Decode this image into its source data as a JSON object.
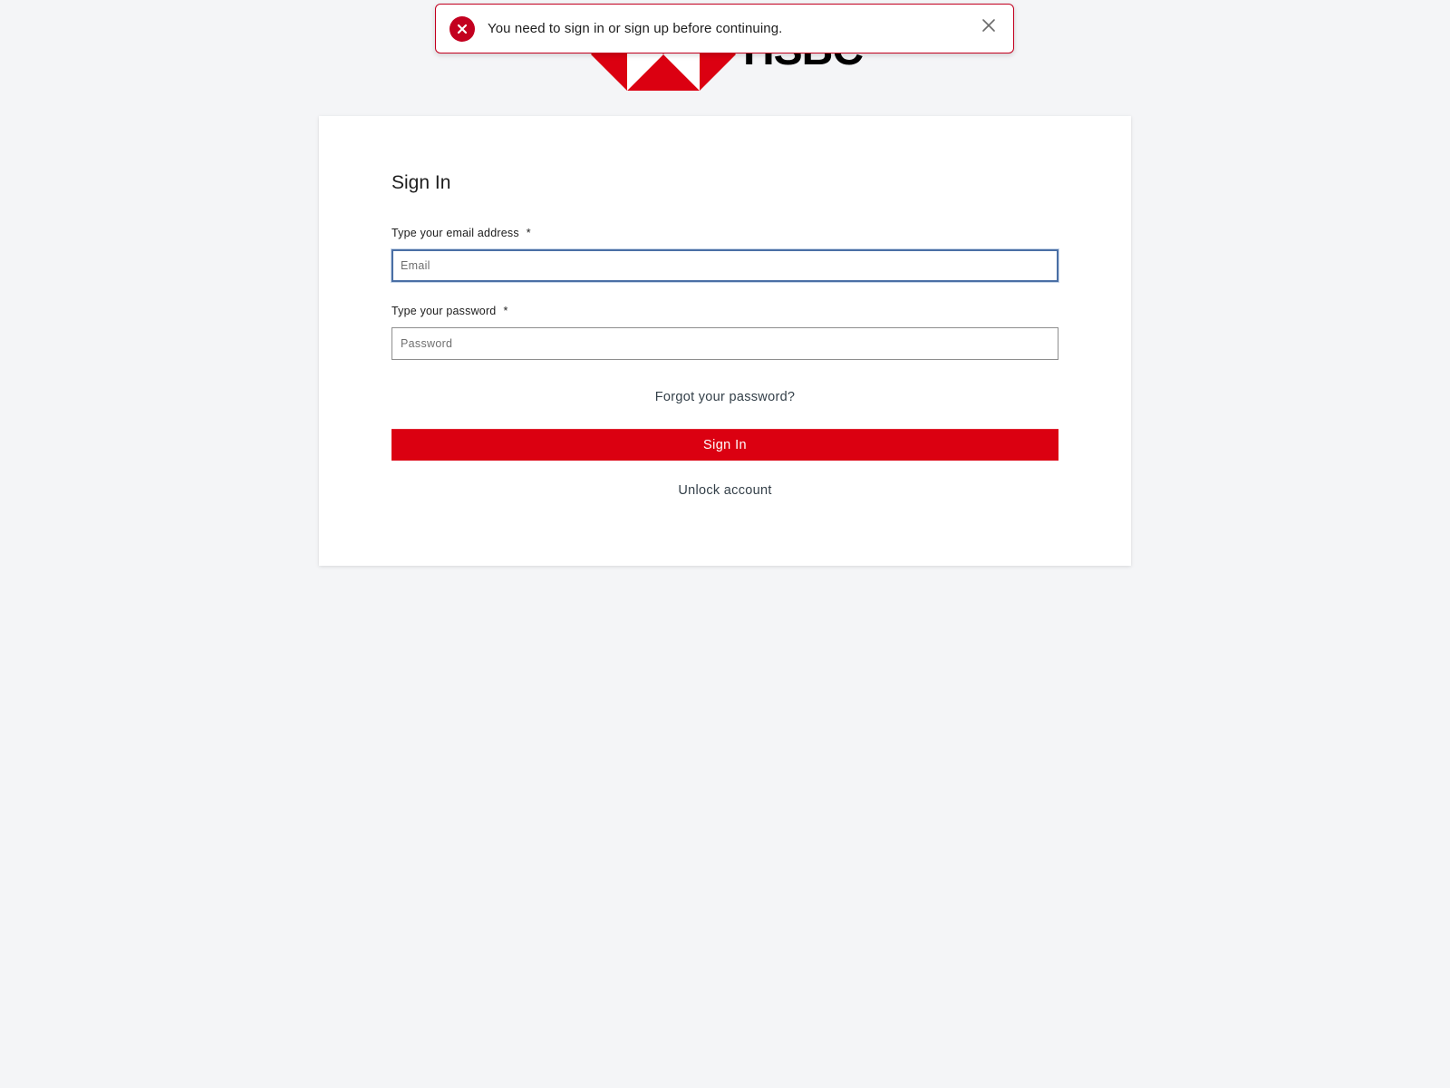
{
  "brand": {
    "name": "HSBC",
    "red": "#db0011",
    "logo_icon": "hsbc-hexagon-logo"
  },
  "toast": {
    "type": "error",
    "icon": "error-circle-icon",
    "message": "You need to sign in or sign up before continuing.",
    "close_icon": "close-icon",
    "color": "#c3001f"
  },
  "form": {
    "title": "Sign In",
    "email": {
      "label": "Type your email address",
      "required_marker": "*",
      "placeholder": "Email",
      "value": ""
    },
    "password": {
      "label": "Type your password",
      "required_marker": "*",
      "placeholder": "Password",
      "value": ""
    },
    "forgot_link": "Forgot your password?",
    "submit_label": "Sign In",
    "unlock_link": "Unlock account"
  },
  "colors": {
    "background": "#f4f5f7",
    "card": "#ffffff",
    "focus_border": "#4a6fa5",
    "link": "#333f48"
  }
}
